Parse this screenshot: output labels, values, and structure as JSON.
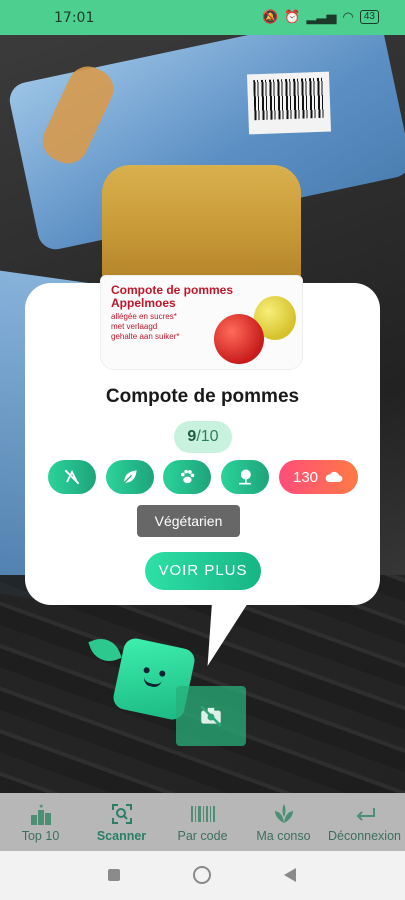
{
  "status_bar": {
    "time": "17:01",
    "battery": "43"
  },
  "product": {
    "image_label_line1": "Compote de pommes",
    "image_label_line2": "Appelmoes",
    "image_label_line3": "allégée en sucres*",
    "image_label_line4": "met verlaagd",
    "image_label_line5": "gehalte aan suiker*",
    "title": "Compote de pommes",
    "score_value": "9",
    "score_max": "/10"
  },
  "badges": [
    {
      "icon": "no-gluten-icon"
    },
    {
      "icon": "leaf-icon"
    },
    {
      "icon": "paw-icon"
    },
    {
      "icon": "tree-icon"
    },
    {
      "icon": "cloud-icon",
      "value": "130"
    }
  ],
  "tooltip": "Végétarien",
  "more_button": "VOIR PLUS",
  "bottom_nav": [
    {
      "label": "Top 10",
      "icon": "podium-icon",
      "active": false
    },
    {
      "label": "Scanner",
      "icon": "scan-icon",
      "active": true
    },
    {
      "label": "Par code",
      "icon": "barcode-icon",
      "active": false
    },
    {
      "label": "Ma conso",
      "icon": "plant-icon",
      "active": false
    },
    {
      "label": "Déconnexion",
      "icon": "logout-icon",
      "active": false
    }
  ],
  "colors": {
    "accent": "#2bd39a",
    "status_bar": "#4ccf8f",
    "co2_badge": "#ff5a68",
    "nav_bg": "#b7b7b7"
  }
}
